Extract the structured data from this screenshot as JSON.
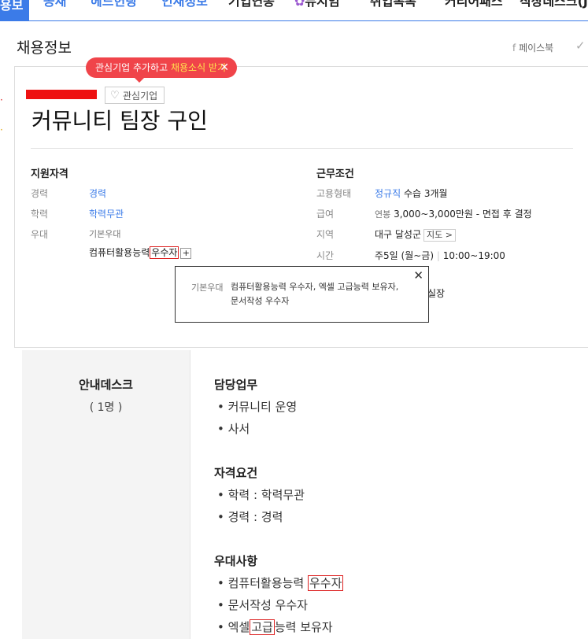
{
  "nav": {
    "tabs": [
      {
        "label": "용보"
      },
      {
        "label": "공채"
      },
      {
        "label": "헤드헌팅"
      },
      {
        "label": "인재정보"
      },
      {
        "label": "기업연봉"
      },
      {
        "label": "뮤지엄"
      },
      {
        "label": "취업톡톡"
      },
      {
        "label": "커리어패스"
      },
      {
        "label": "직장데스크(J"
      }
    ]
  },
  "page": {
    "title": "채용정보",
    "share_label": "페이스북"
  },
  "promo_tooltip": {
    "text": "관심기업 추가하고 ",
    "highlight": "채용소식 받기",
    "close": "✕"
  },
  "company": {
    "fav_label": "관심기업"
  },
  "job": {
    "title": "커뮤니티 팀장 구인"
  },
  "qualifications": {
    "heading": "지원자격",
    "career_label": "경력",
    "career_value": "경력",
    "edu_label": "학력",
    "edu_value": "학력무관",
    "pref_label": "우대",
    "pref_basic": "기본우대",
    "pref_item": "컴퓨터활용능력",
    "pref_highlight": "우수자",
    "pref_more": "+"
  },
  "conditions": {
    "heading": "근무조건",
    "type_label": "고용형태",
    "type_value": "정규직",
    "type_extra": "수습 3개월",
    "salary_label": "급여",
    "salary_prefix": "연봉",
    "salary_value": "3,000~3,000만원 - 면접 후 결정",
    "region_label": "지역",
    "region_value": "대구 달성군",
    "map_button": "지도 >",
    "time_label": "시간",
    "time_value": "주5일 (월~금)",
    "time_hours": "10:00~19:00",
    "hidden_partial": "실장"
  },
  "popup": {
    "label": "기본우대",
    "text": "컴퓨터활용능력 우수자, 엑셀 고급능력 보유자, 문서작성 우수자",
    "close": "✕"
  },
  "detail": {
    "department": "안내데스크",
    "headcount": "( 1명 )",
    "duties_heading": "담당업무",
    "duties": [
      "• 커뮤니티 운영",
      "• 사서"
    ],
    "req_heading": "자격요건",
    "requirements": [
      "• 학력 : 학력무관",
      "• 경력 : 경력"
    ],
    "pref_heading": "우대사항",
    "pref_1_prefix": "• 컴퓨터활용능력 ",
    "pref_1_box": "우수자",
    "pref_2": "• 문서작성 우수자",
    "pref_3_prefix": "• 엑셀",
    "pref_3_box": "고급",
    "pref_3_suffix": "능력 보유자"
  },
  "colors": {
    "accent": "#3b7be8",
    "promo": "#f0444a",
    "highlight_box": "#dd2222"
  }
}
